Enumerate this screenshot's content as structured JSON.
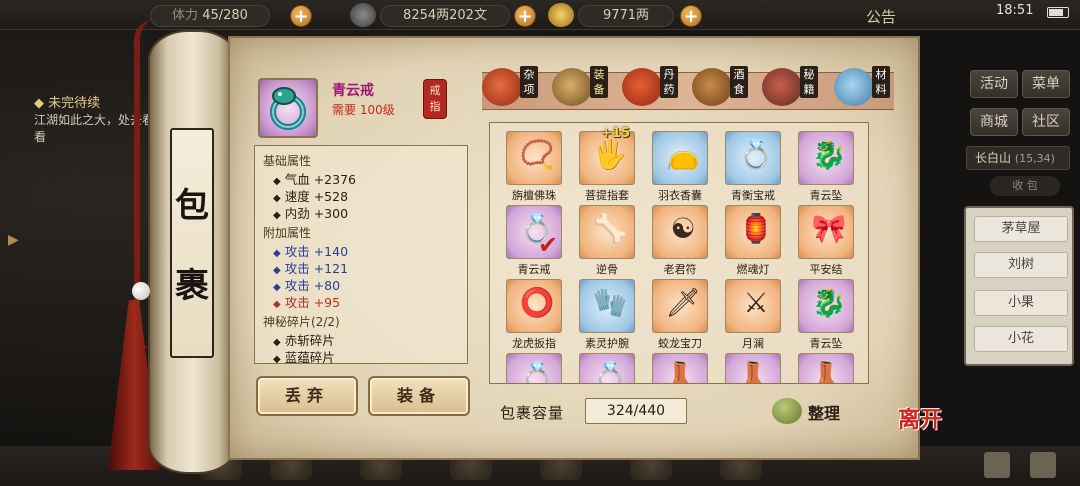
{
  "top_bar": {
    "stamina": "45/280",
    "stamina_prefix": "体力",
    "money": "8254两202文",
    "gold": "9771两",
    "notice": "公告",
    "time": "18:51"
  },
  "quest": {
    "title": "◆ 未完待续",
    "text": "江湖如此之大，处去看看"
  },
  "right_panel": {
    "buttons": [
      "活动",
      "菜单",
      "商城",
      "社区"
    ],
    "location_name": "长白山",
    "location_coords": "(15,34)",
    "bag_tab": "收 包",
    "npcs": [
      "茅草屋",
      "刘树",
      "小果",
      "小花"
    ]
  },
  "scroll": {
    "title_char_1": "包",
    "title_char_2": "裹"
  },
  "selected_item": {
    "name": "青云戒",
    "requirement": "需要 100级",
    "type": "戒指",
    "icon": "jade-ring-icon",
    "base_section": "基础属性",
    "base_attrs": [
      {
        "label": "气血",
        "value": "+2376"
      },
      {
        "label": "速度",
        "value": "+528"
      },
      {
        "label": "内劲",
        "value": "+300"
      }
    ],
    "extra_section": "附加属性",
    "extra_attrs": [
      {
        "label": "攻击",
        "value": "+140",
        "color": "blue"
      },
      {
        "label": "攻击",
        "value": "+121",
        "color": "blue"
      },
      {
        "label": "攻击",
        "value": "+80",
        "color": "blue"
      },
      {
        "label": "攻击",
        "value": "+95",
        "color": "red"
      }
    ],
    "shard_section": "神秘碎片(2/2)",
    "shards": [
      "赤斩碎片",
      "蓝蕴碎片"
    ]
  },
  "actions": {
    "discard": "丢弃",
    "equip": "装备"
  },
  "categories": [
    {
      "label": "杂项",
      "icon": "misc-pot-icon"
    },
    {
      "label": "装备",
      "icon": "equipment-icon",
      "active": true
    },
    {
      "label": "丹药",
      "icon": "pill-icon"
    },
    {
      "label": "酒食",
      "icon": "wine-food-icon"
    },
    {
      "label": "秘籍",
      "icon": "manual-book-icon"
    },
    {
      "label": "材料",
      "icon": "material-crystal-icon"
    }
  ],
  "inventory": [
    {
      "name": "旃檀佛珠",
      "quality": "orange",
      "icon": "prayer-beads-icon"
    },
    {
      "name": "菩提指套",
      "quality": "orange",
      "icon": "finger-guard-icon",
      "plus": "+15"
    },
    {
      "name": "羽衣香囊",
      "quality": "blue",
      "icon": "sachet-icon"
    },
    {
      "name": "青衡宝戒",
      "quality": "blue",
      "icon": "ring-icon"
    },
    {
      "name": "青云坠",
      "quality": "purple",
      "icon": "pendant-icon"
    },
    {
      "name": "青云戒",
      "quality": "purple",
      "icon": "jade-ring-icon",
      "selected": true
    },
    {
      "name": "逆骨",
      "quality": "orange",
      "icon": "bone-armor-icon"
    },
    {
      "name": "老君符",
      "quality": "orange",
      "icon": "talisman-icon"
    },
    {
      "name": "燃魂灯",
      "quality": "orange",
      "icon": "lantern-icon"
    },
    {
      "name": "平安结",
      "quality": "orange",
      "icon": "knot-icon"
    },
    {
      "name": "龙虎扳指",
      "quality": "orange",
      "icon": "thumb-ring-icon"
    },
    {
      "name": "素灵护腕",
      "quality": "blue",
      "icon": "bracer-icon"
    },
    {
      "name": "蛟龙宝刀",
      "quality": "orange",
      "icon": "saber-icon"
    },
    {
      "name": "月澜",
      "quality": "orange",
      "icon": "sword-icon"
    },
    {
      "name": "青云坠",
      "quality": "purple",
      "icon": "pendant-icon"
    },
    {
      "name": "",
      "quality": "purple",
      "icon": "jade-ring-icon"
    },
    {
      "name": "",
      "quality": "purple",
      "icon": "jade-ring-icon"
    },
    {
      "name": "",
      "quality": "purple",
      "icon": "boots-icon"
    },
    {
      "name": "",
      "quality": "purple",
      "icon": "boots-icon"
    },
    {
      "name": "",
      "quality": "purple",
      "icon": "boots-icon"
    }
  ],
  "capacity": {
    "label": "包裹容量",
    "value": "324/440"
  },
  "sort_label": "整理",
  "leave_label": "离开",
  "colors": {
    "item_name": "#a1167a",
    "requirement": "#c22a1c",
    "attr_blue": "#2a3e98",
    "attr_red": "#b0312a"
  }
}
